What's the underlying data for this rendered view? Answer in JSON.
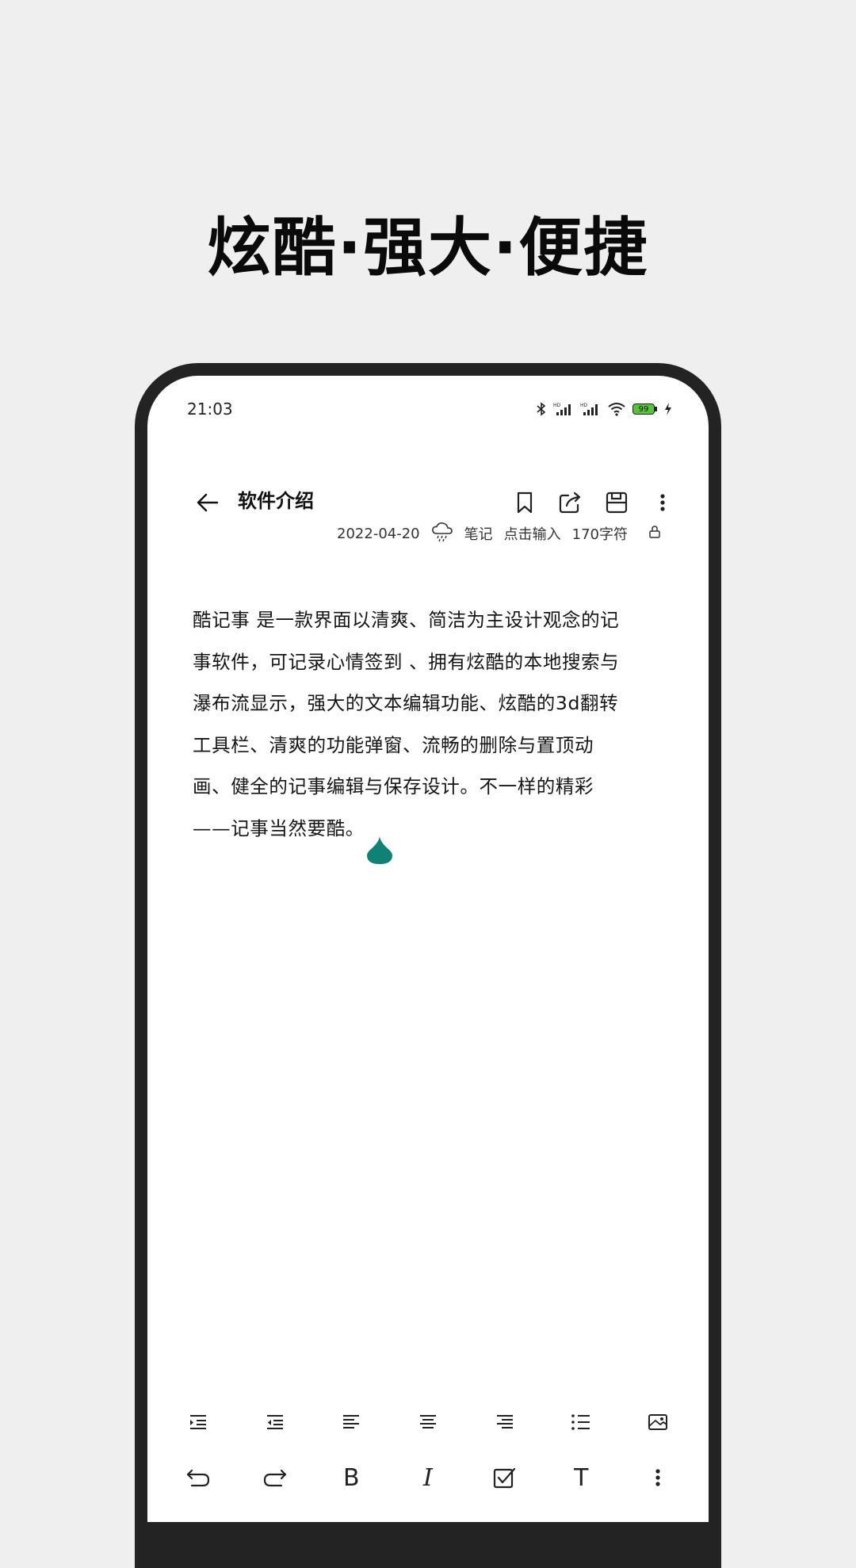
{
  "banner": {
    "headline": "炫酷·强大·便捷"
  },
  "status_bar": {
    "time": "21:03",
    "battery": "99"
  },
  "note_header": {
    "title": "软件介绍"
  },
  "meta": {
    "date": "2022-04-20",
    "category": "笔记",
    "input_hint": "点击输入",
    "char_count": "170字符"
  },
  "note": {
    "lines": [
      "酷记事 是一款界面以清爽、简洁为主设计观念的记",
      "事软件，可记录心情签到 、拥有炫酷的本地搜索与",
      "瀑布流显示，强大的文本编辑功能、炫酷的3d翻转",
      "工具栏、清爽的功能弹窗、流畅的删除与置顶动",
      "画、健全的记事编辑与保存设计。不一样的精彩",
      "——记事当然要酷。"
    ]
  },
  "format_bar": {
    "bold_label": "B",
    "italic_label": "I",
    "text_label": "T"
  },
  "colors": {
    "cursor": "#0e8274",
    "frame": "#232323",
    "background": "#efefef"
  }
}
